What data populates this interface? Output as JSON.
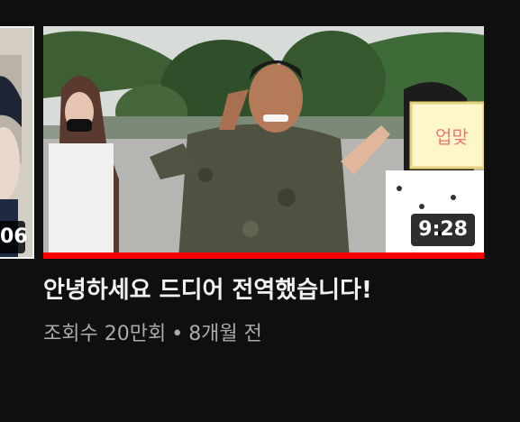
{
  "prev_video": {
    "duration_tail": "06"
  },
  "video": {
    "title": "안녕하세요 드디어 전역했습니다!",
    "duration": "9:28",
    "views": "조회수 20만회",
    "separator": "•",
    "age": "8개월 전",
    "progress_fraction": 1.0,
    "progress_color": "#ff0000"
  }
}
